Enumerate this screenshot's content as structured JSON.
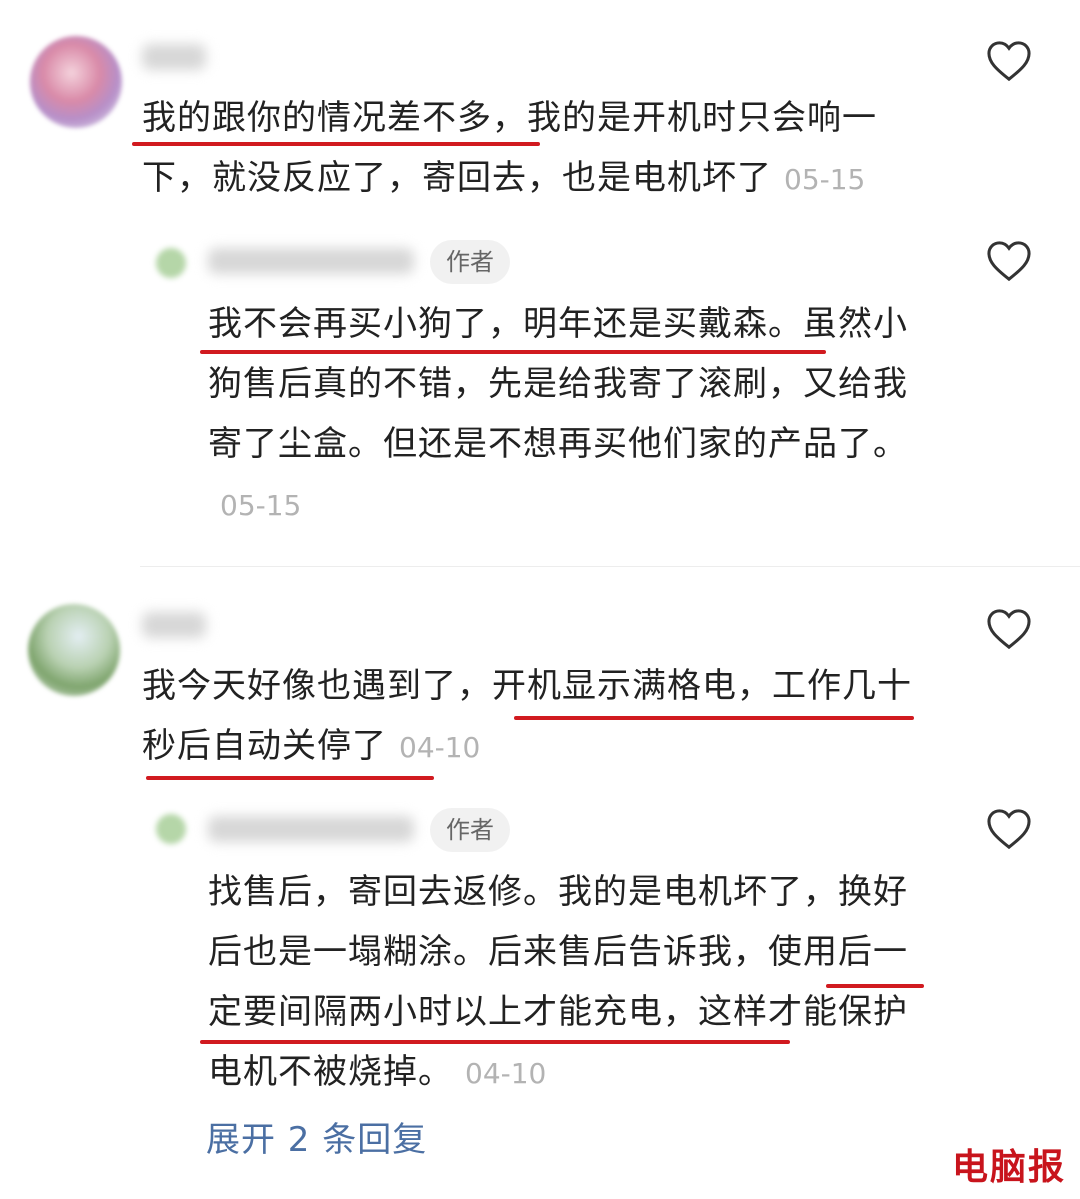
{
  "comments": [
    {
      "text": "我的跟你的情况差不多，我的是开机时只会响一下，就没反应了，寄回去，也是电机坏了",
      "date": "05-15",
      "reply": {
        "badge": "作者",
        "text": "我不会再买小狗了，明年还是买戴森。虽然小狗售后真的不错，先是给我寄了滚刷，又给我寄了尘盒。但还是不想再买他们家的产品了。",
        "date": "05-15"
      }
    },
    {
      "text": "我今天好像也遇到了，开机显示满格电，工作几十秒后自动关停了",
      "date": "04-10",
      "reply": {
        "badge": "作者",
        "text": "找售后，寄回去返修。我的是电机坏了，换好后也是一塌糊涂。后来售后告诉我，使用后一定要间隔两小时以上才能充电，这样才能保护电机不被烧掉。",
        "date": "04-10"
      }
    }
  ],
  "expand_replies": "展开 2 条回复",
  "watermark": "电脑报",
  "colors": {
    "underline": "#d11a1f",
    "link": "#4b6fa3",
    "date": "#b3b3b3"
  }
}
